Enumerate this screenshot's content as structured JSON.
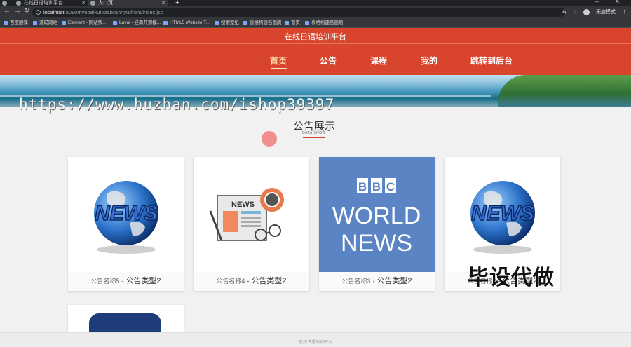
{
  "browser": {
    "tabs": [
      {
        "label": "在线日语培训平台",
        "active": false
      },
      {
        "label": "在线日语培训平台",
        "active": true
      },
      {
        "label": "人口页",
        "active": false
      }
    ],
    "new_tab": "+",
    "url_host": "localhost",
    "url_path": ":8080/riyupeixun/zaixianriyu/front/index.jsp",
    "profile_label": "无痕模式",
    "bookmarks": [
      "百度翻译",
      "源码网站",
      "Element - 网站快...",
      "Layui - 经典开源模...",
      "HTML5 Website T...",
      "搜索壁纸",
      "表格构建名画刷",
      "首页",
      "表格构建名画刷"
    ]
  },
  "header": {
    "site_title": "在线日语培训平台",
    "nav": [
      "首页",
      "公告",
      "课程",
      "我的",
      "跳转到后台"
    ],
    "active_index": 0
  },
  "watermark": "https://www.huzhan.com/ishop39397",
  "section": {
    "title": "公告展示",
    "subtitle": "DATA SHOW"
  },
  "cards": [
    {
      "name": "公告名称5",
      "type": "公告类型2",
      "image": "news-globe"
    },
    {
      "name": "公告名称4",
      "type": "公告类型2",
      "image": "news-paper-illustration"
    },
    {
      "name": "公告名称3",
      "type": "公告类型2",
      "image": "bbc-world-news"
    },
    {
      "name": "公告名称2",
      "type": "公告类型2",
      "image": "news-globe"
    }
  ],
  "bbc": {
    "line1": "BBC",
    "line2": "WORLD",
    "line3": "NEWS"
  },
  "news_word": "NEWS",
  "stamp": "毕设代做",
  "footer": "在线日语培训平台",
  "colors": {
    "header": "#d9452c",
    "accent": "#d9452c",
    "bbc_bg": "#5b84c4"
  }
}
